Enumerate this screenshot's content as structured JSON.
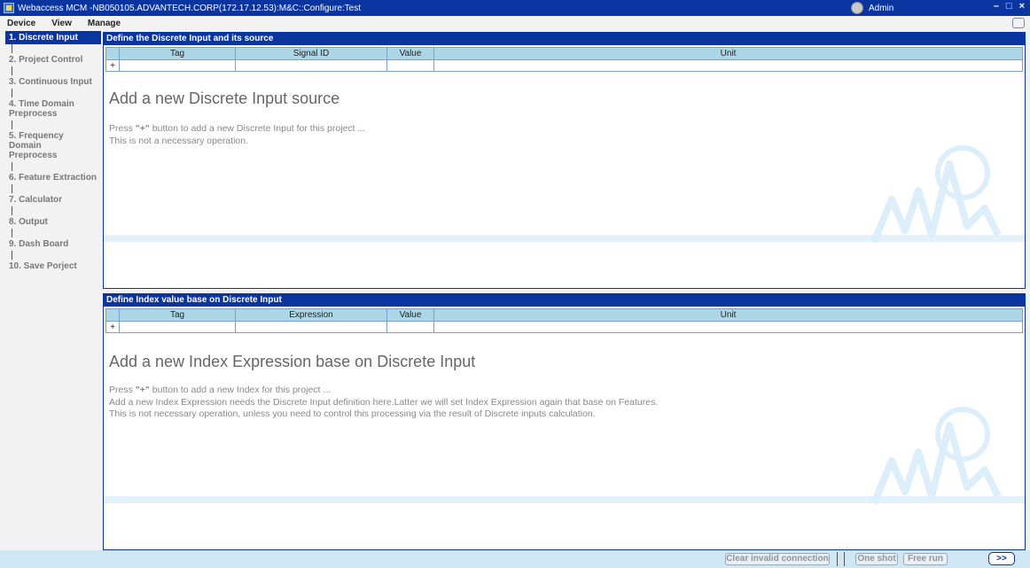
{
  "window": {
    "title": "Webaccess MCM -NB050105.ADVANTECH.CORP(172.17.12.53):M&C::Configure:Test",
    "user": "Admin",
    "controls": [
      "–",
      "□",
      "×"
    ]
  },
  "menu": [
    "Device",
    "View",
    "Manage"
  ],
  "steps": [
    {
      "label": "1. Discrete Input",
      "active": true
    },
    {
      "label": "2. Project Control"
    },
    {
      "label": "3. Continuous Input"
    },
    {
      "label": "4. Time Domain\nPreprocess"
    },
    {
      "label": "5. Frequency Domain\nPreprocess"
    },
    {
      "label": "6. Feature Extraction"
    },
    {
      "label": "7. Calculator"
    },
    {
      "label": "8. Output"
    },
    {
      "label": "9. Dash Board"
    },
    {
      "label": "10. Save Porject"
    }
  ],
  "panel1": {
    "header": "Define the Discrete Input and its source",
    "columns": [
      "Tag",
      "Signal ID",
      "Value",
      "Unit"
    ],
    "add_symbol": "+",
    "title": "Add a new Discrete Input source",
    "hint_prefix": "Press ",
    "hint_key": "\"+\"",
    "hint_suffix": " button to add a new Discrete Input for this project ...",
    "hint2": "This is not a necessary operation."
  },
  "panel2": {
    "header": "Define Index value base on Discrete Input",
    "columns": [
      "Tag",
      "Expression",
      "Value",
      "Unit"
    ],
    "add_symbol": "+",
    "title": "Add a new Index Expression base on Discrete Input",
    "hint_prefix": "Press ",
    "hint_key": "\"+\"",
    "hint_suffix": " button to add a new Index for this project ...",
    "hint2": "Add a new Index Expression needs the Discrete Input definition here.Latter we will set Index Expression again that base on Features.",
    "hint3": "This is not necessary operation, unless you need to control this processing via the result of Discrete inputs calculation."
  },
  "statusbar": {
    "clear_label": "Clear invalid connection",
    "oneshot_label": "One shot",
    "freerun_label": "Free run",
    "next_label": ">>"
  }
}
